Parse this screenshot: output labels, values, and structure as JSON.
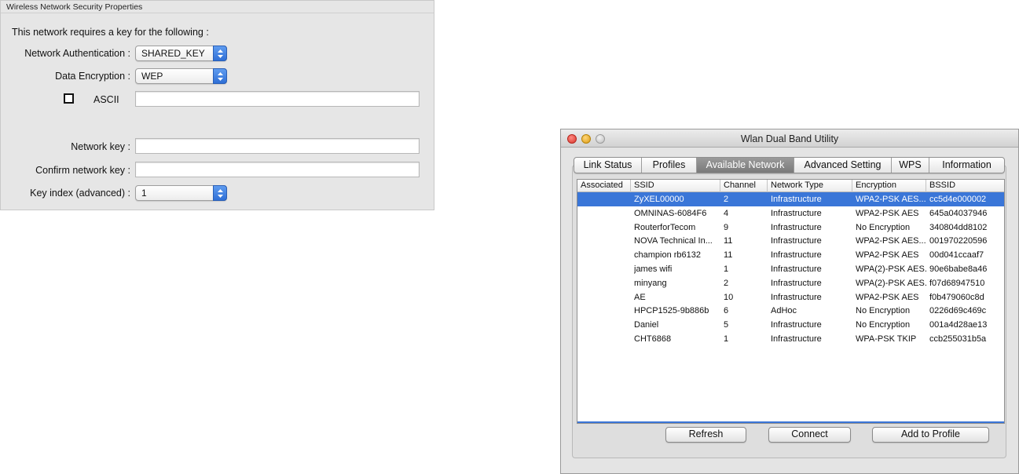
{
  "security_panel": {
    "title": "Wireless Network Security Properties",
    "header": "This network requires a key for the following :",
    "auth_label": "Network Authentication :",
    "auth_value": "SHARED_KEY",
    "encryption_label": "Data Encryption :",
    "encryption_value": "WEP",
    "ascii_label": "ASCII",
    "ascii_checked": false,
    "network_key_label": "Network key :",
    "confirm_key_label": "Confirm network key :",
    "key_index_label": "Key index (advanced) :",
    "key_index_value": "1"
  },
  "window": {
    "title": "Wlan Dual Band Utility",
    "tabs": [
      {
        "label": "Link Status"
      },
      {
        "label": "Profiles"
      },
      {
        "label": "Available Network"
      },
      {
        "label": "Advanced Setting"
      },
      {
        "label": "WPS"
      },
      {
        "label": "Information"
      }
    ],
    "active_tab": "Available Network",
    "columns": [
      "Associated",
      "SSID",
      "Channel",
      "Network Type",
      "Encryption",
      "BSSID"
    ],
    "rows": [
      {
        "associated": "",
        "ssid": "ZyXEL00000",
        "channel": "2",
        "type": "Infrastructure",
        "encryption": "WPA2-PSK AES...",
        "bssid": "cc5d4e000002",
        "selected": true
      },
      {
        "associated": "",
        "ssid": "OMNINAS-6084F6",
        "channel": "4",
        "type": "Infrastructure",
        "encryption": "WPA2-PSK AES",
        "bssid": "645a04037946"
      },
      {
        "associated": "",
        "ssid": "RouterforTecom",
        "channel": "9",
        "type": "Infrastructure",
        "encryption": "No Encryption",
        "bssid": "340804dd8102"
      },
      {
        "associated": "",
        "ssid": "NOVA Technical In...",
        "channel": "11",
        "type": "Infrastructure",
        "encryption": "WPA2-PSK AES...",
        "bssid": "001970220596"
      },
      {
        "associated": "",
        "ssid": "champion rb6132",
        "channel": "11",
        "type": "Infrastructure",
        "encryption": "WPA2-PSK AES",
        "bssid": "00d041ccaaf7"
      },
      {
        "associated": "",
        "ssid": "james wifi",
        "channel": "1",
        "type": "Infrastructure",
        "encryption": "WPA(2)-PSK AES...",
        "bssid": "90e6babe8a46"
      },
      {
        "associated": "",
        "ssid": "minyang",
        "channel": "2",
        "type": "Infrastructure",
        "encryption": "WPA(2)-PSK AES...",
        "bssid": "f07d68947510"
      },
      {
        "associated": "",
        "ssid": "AE",
        "channel": "10",
        "type": "Infrastructure",
        "encryption": "WPA2-PSK AES",
        "bssid": "f0b479060c8d"
      },
      {
        "associated": "",
        "ssid": "HPCP1525-9b886b",
        "channel": "6",
        "type": "AdHoc",
        "encryption": "No Encryption",
        "bssid": "0226d69c469c"
      },
      {
        "associated": "",
        "ssid": "Daniel",
        "channel": "5",
        "type": "Infrastructure",
        "encryption": "No Encryption",
        "bssid": "001a4d28ae13"
      },
      {
        "associated": "",
        "ssid": "CHT6868",
        "channel": "1",
        "type": "Infrastructure",
        "encryption": "WPA-PSK TKIP",
        "bssid": "ccb255031b5a"
      }
    ],
    "buttons": {
      "refresh": "Refresh",
      "connect": "Connect",
      "add_to_profile": "Add to Profile"
    }
  },
  "colors": {
    "selection": "#3a76d8",
    "select_arrow": "#2f6fd6",
    "active_tab": "#8a8a8a"
  }
}
